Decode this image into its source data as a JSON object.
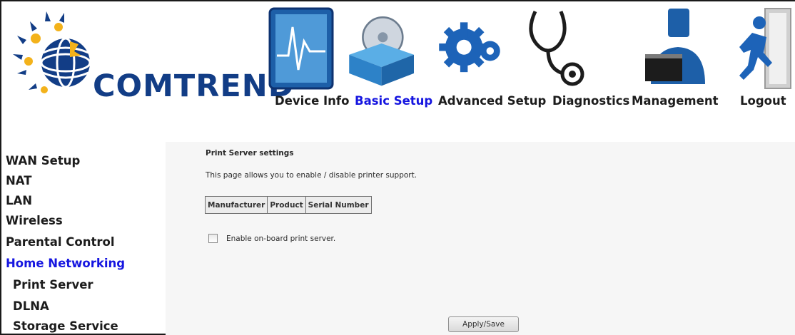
{
  "brand": {
    "name": "COMTREND"
  },
  "nav": [
    {
      "label": "Device Info",
      "icon": "monitor-chart-icon"
    },
    {
      "label": "Basic Setup",
      "icon": "box-disc-icon",
      "active": true
    },
    {
      "label": "Advanced Setup",
      "icon": "gears-icon"
    },
    {
      "label": "Diagnostics",
      "icon": "stethoscope-icon"
    },
    {
      "label": "Management",
      "icon": "user-laptop-icon"
    },
    {
      "label": "Logout",
      "icon": "exit-runner-icon"
    }
  ],
  "sidebar": {
    "items": [
      {
        "label": "WAN Setup"
      },
      {
        "label": "NAT"
      },
      {
        "label": "LAN"
      },
      {
        "label": "Wireless"
      },
      {
        "label": "Parental Control"
      },
      {
        "label": "Home Networking",
        "active": true
      },
      {
        "label": "Print Server",
        "sub": true
      },
      {
        "label": "DLNA",
        "sub": true
      },
      {
        "label": "Storage Service",
        "sub": true
      }
    ]
  },
  "main": {
    "title": "Print Server settings",
    "description": "This page allows you to enable / disable printer support.",
    "table": {
      "columns": [
        "Manufacturer",
        "Product",
        "Serial Number"
      ],
      "rows": []
    },
    "checkbox": {
      "label": "Enable on-board print server.",
      "checked": false
    },
    "apply_label": "Apply/Save"
  },
  "colors": {
    "brand": "#123d86",
    "active_link": "#1515e0",
    "panel_bg": "#f6f6f6"
  }
}
